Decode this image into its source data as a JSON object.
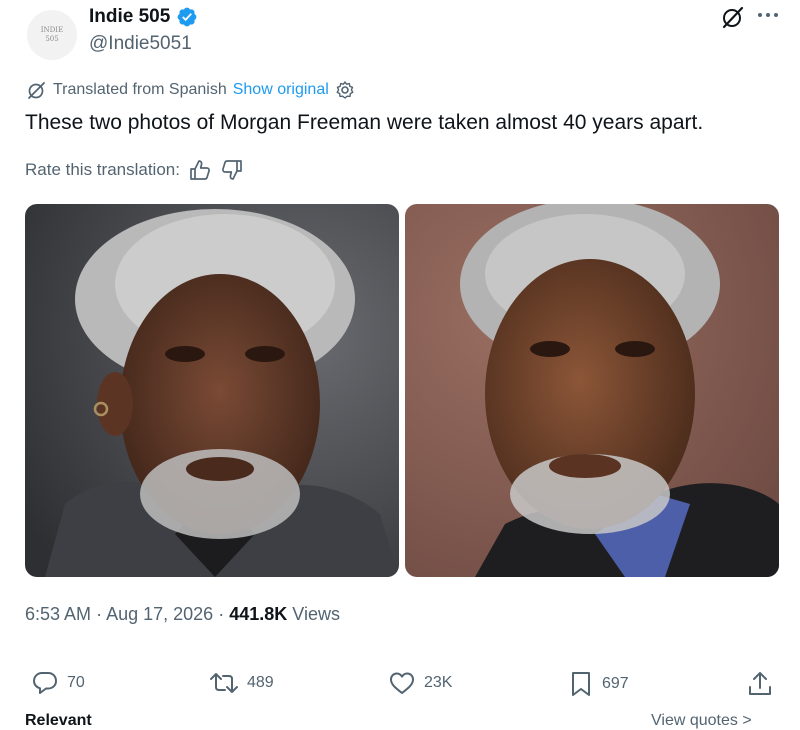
{
  "author": {
    "avatar_text_1": "INDIE",
    "avatar_text_2": "505",
    "display_name": "Indie 505",
    "handle": "@Indie5051",
    "verified_color": "#1d9bf0"
  },
  "translation": {
    "label": "Translated from Spanish",
    "show_original": "Show original"
  },
  "tweet_text": "These two photos of Morgan Freeman were taken almost 40 years apart.",
  "rate": {
    "label": "Rate this translation:"
  },
  "meta": {
    "time": "6:53 AM",
    "date": "Aug 17, 2026",
    "views_count": "441.8K",
    "views_label": "Views"
  },
  "actions": {
    "replies": "70",
    "reposts": "489",
    "likes": "23K",
    "bookmarks": "697"
  },
  "footer": {
    "left": "Relevant",
    "right": "View quotes >"
  },
  "icons": [
    "grok-icon",
    "more-icon",
    "translate-icon",
    "settings-icon",
    "thumbs-up-icon",
    "thumbs-down-icon",
    "reply-icon",
    "repost-icon",
    "like-icon",
    "bookmark-icon",
    "share-icon"
  ]
}
